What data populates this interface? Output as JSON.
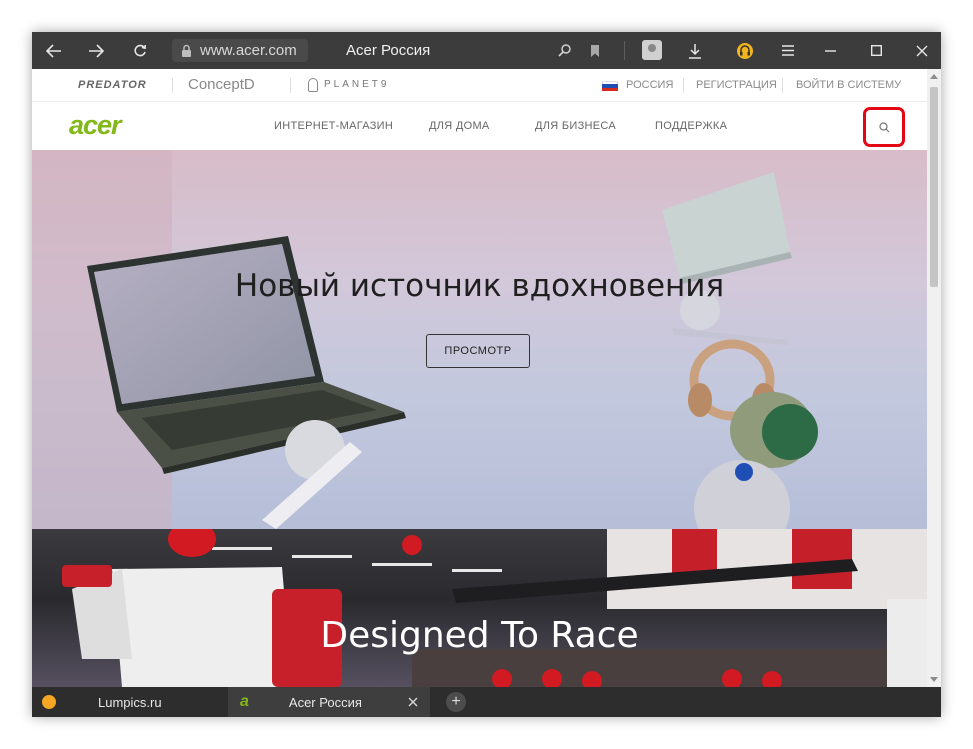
{
  "browser": {
    "url": "www.acer.com",
    "page_title": "Acer Россия",
    "tabs": [
      {
        "label": "Lumpics.ru",
        "icon": "orange-circle-favicon"
      },
      {
        "label": "Acer Россия",
        "icon": "acer-favicon"
      }
    ]
  },
  "acer": {
    "brands": [
      "PREDATOR",
      "ConceptD",
      "PLANET9"
    ],
    "top_links": {
      "region": "РОССИЯ",
      "register": "РЕГИСТРАЦИЯ",
      "login": "ВОЙТИ В СИСТЕМУ"
    },
    "logo": "acer",
    "nav": [
      "ИНТЕРНЕТ-МАГАЗИН",
      "ДЛЯ ДОМА",
      "ДЛЯ БИЗНЕСА",
      "ПОДДЕРЖКА"
    ],
    "hero": {
      "title": "Новый источник вдохновения",
      "button": "ПРОСМОТР"
    },
    "race_banner": {
      "title": "Designed To Race"
    }
  },
  "colors": {
    "acer_green": "#83b81a",
    "highlight_red": "#e30613"
  }
}
